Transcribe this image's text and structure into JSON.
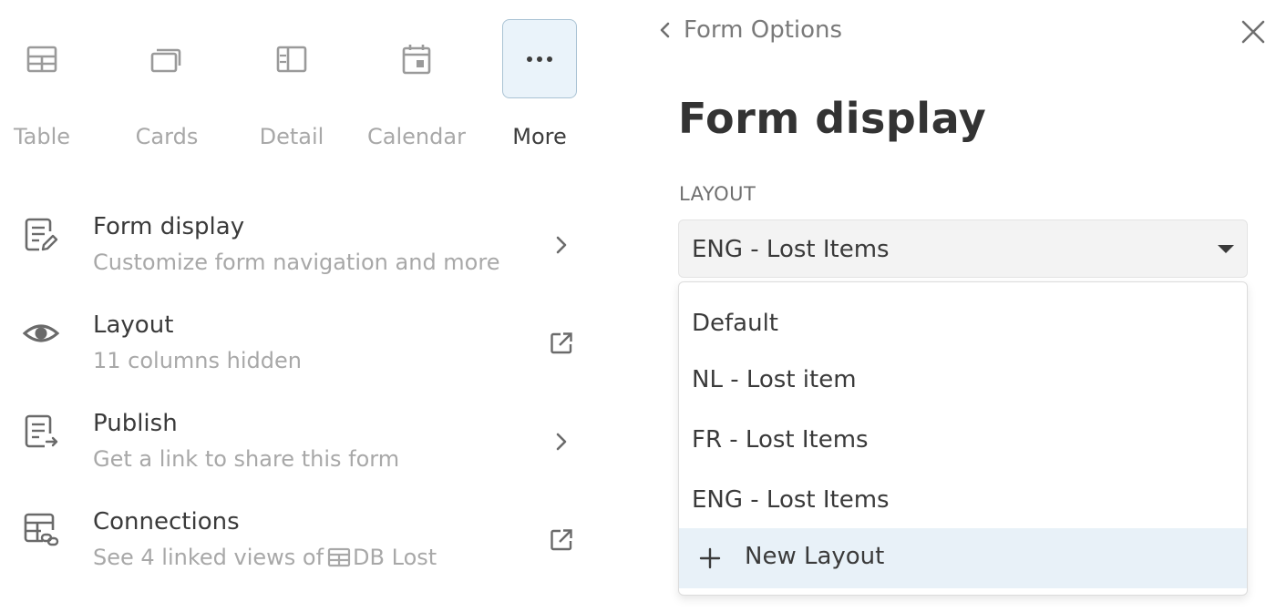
{
  "views": [
    {
      "label": "Table",
      "icon": "table-icon",
      "active": false
    },
    {
      "label": "Cards",
      "icon": "cards-icon",
      "active": false
    },
    {
      "label": "Detail",
      "icon": "detail-icon",
      "active": false
    },
    {
      "label": "Calendar",
      "icon": "calendar-icon",
      "active": false
    },
    {
      "label": "More",
      "icon": "more-icon",
      "active": true
    }
  ],
  "menu": [
    {
      "title": "Form display",
      "subtitle": "Customize form navigation and more",
      "icon": "form-edit-icon",
      "action": "chevron-right-icon"
    },
    {
      "title": "Layout",
      "subtitle": "11 columns hidden",
      "icon": "eye-icon",
      "action": "external-link-icon"
    },
    {
      "title": "Publish",
      "subtitle": "Get a link to share this form",
      "icon": "publish-icon",
      "action": "chevron-right-icon"
    },
    {
      "title": "Connections",
      "subtitle_prefix": "See 4 linked views of",
      "subtitle_link": "DB Lost",
      "icon": "connections-icon",
      "action": "external-link-icon"
    }
  ],
  "panel": {
    "back_label": "Form Options",
    "heading": "Form display",
    "layout_label": "LAYOUT",
    "selected_layout": "ENG - Lost Items",
    "options": [
      "Default",
      "NL - Lost item",
      "FR - Lost Items",
      "ENG - Lost Items"
    ],
    "new_option": "New Layout"
  },
  "colors": {
    "active_bg": "#eaf3fa",
    "active_border": "#aac3d4",
    "muted_text": "#a8a8a8",
    "highlight_bg": "#e8f1f8"
  }
}
